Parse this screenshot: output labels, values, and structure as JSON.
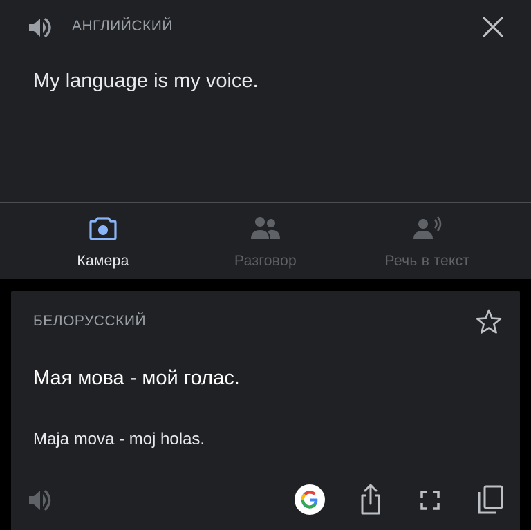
{
  "source": {
    "language": "АНГЛИЙСКИЙ",
    "text": "My language is my voice."
  },
  "modes": [
    {
      "label": "Камера",
      "active": true
    },
    {
      "label": "Разговор",
      "active": false
    },
    {
      "label": "Речь в текст",
      "active": false
    }
  ],
  "result": {
    "language": "БЕЛОРУССКИЙ",
    "text": "Мая мова - мой голас.",
    "transliteration": "Maja mova - moj holas."
  },
  "colors": {
    "background": "#000000",
    "panel": "#202124",
    "active": "#8ab4f8",
    "inactive": "#5f6368",
    "text_primary": "#e8eaed",
    "text_secondary": "#9aa0a6"
  },
  "icons": {
    "source_speaker": "speaker-icon",
    "close": "close-icon",
    "camera": "camera-icon",
    "conversation": "people-icon",
    "speech": "speech-to-text-icon",
    "star": "star-icon",
    "result_speaker": "speaker-icon",
    "google": "google-logo-icon",
    "share": "share-icon",
    "fullscreen": "fullscreen-icon",
    "copy": "copy-icon"
  }
}
